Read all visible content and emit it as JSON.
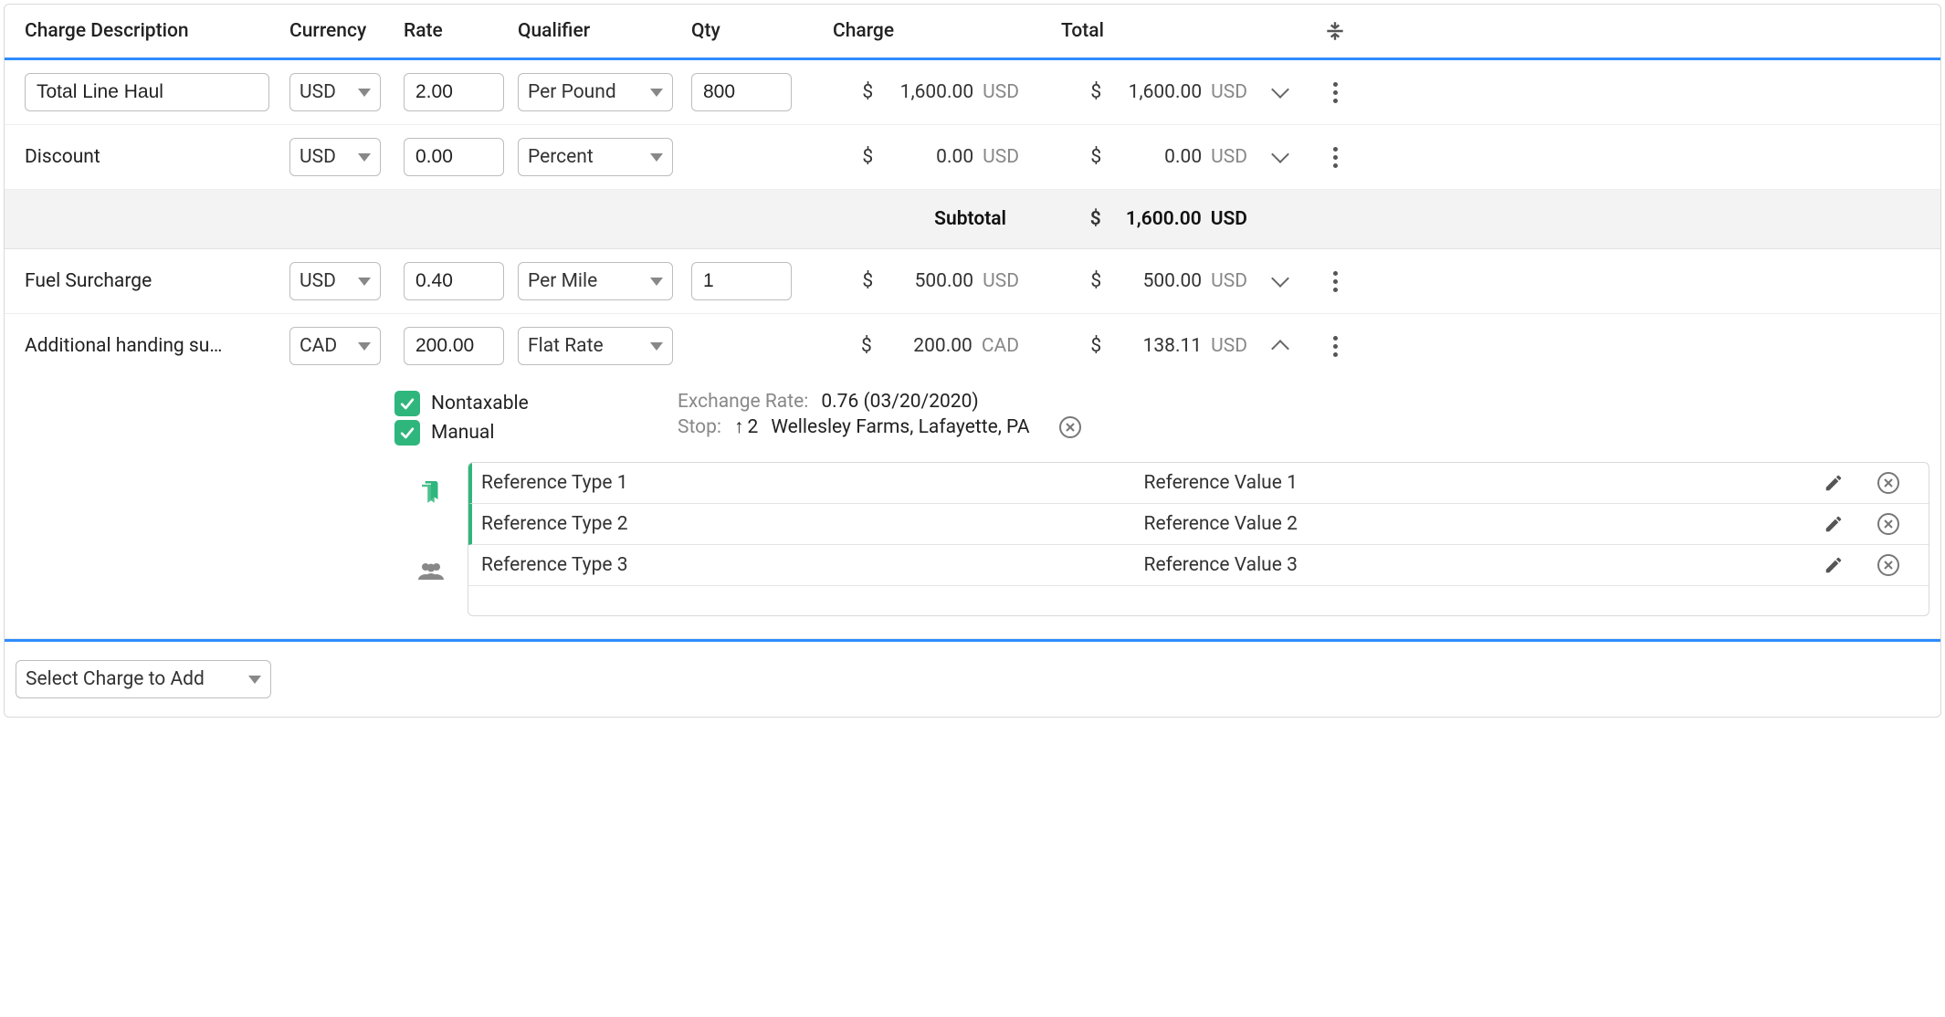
{
  "headers": {
    "description": "Charge Description",
    "currency": "Currency",
    "rate": "Rate",
    "qualifier": "Qualifier",
    "qty": "Qty",
    "charge": "Charge",
    "total": "Total"
  },
  "rows": [
    {
      "description": "Total Line Haul",
      "description_editable": true,
      "currency": "USD",
      "rate": "2.00",
      "qualifier": "Per Pound",
      "qty": "800",
      "qty_visible": true,
      "charge_sym": "$",
      "charge_val": "1,600.00",
      "charge_cur": "USD",
      "total_sym": "$",
      "total_val": "1,600.00",
      "total_cur": "USD",
      "expanded": false
    },
    {
      "description": "Discount",
      "description_editable": false,
      "currency": "USD",
      "rate": "0.00",
      "qualifier": "Percent",
      "qty": "",
      "qty_visible": false,
      "charge_sym": "$",
      "charge_val": "0.00",
      "charge_cur": "USD",
      "total_sym": "$",
      "total_val": "0.00",
      "total_cur": "USD",
      "expanded": false
    }
  ],
  "subtotal": {
    "label": "Subtotal",
    "sym": "$",
    "val": "1,600.00",
    "cur": "USD"
  },
  "rows2": [
    {
      "description": "Fuel Surcharge",
      "description_editable": false,
      "currency": "USD",
      "rate": "0.40",
      "qualifier": "Per Mile",
      "qty": "1",
      "qty_visible": true,
      "charge_sym": "$",
      "charge_val": "500.00",
      "charge_cur": "USD",
      "total_sym": "$",
      "total_val": "500.00",
      "total_cur": "USD",
      "expanded": false
    },
    {
      "description": "Additional handing su…",
      "description_editable": false,
      "currency": "CAD",
      "rate": "200.00",
      "qualifier": "Flat Rate",
      "qty": "",
      "qty_visible": false,
      "charge_sym": "$",
      "charge_val": "200.00",
      "charge_cur": "CAD",
      "total_sym": "$",
      "total_val": "138.11",
      "total_cur": "USD",
      "expanded": true
    }
  ],
  "detail": {
    "nontaxable_label": "Nontaxable",
    "manual_label": "Manual",
    "exchange_label": "Exchange Rate:",
    "exchange_value": "0.76 (03/20/2020)",
    "stop_label": "Stop:",
    "stop_num": "2",
    "stop_location": "Wellesley Farms, Lafayette, PA"
  },
  "references": [
    {
      "type": "Reference Type 1",
      "value": "Reference Value 1",
      "highlight": true
    },
    {
      "type": "Reference Type 2",
      "value": "Reference Value 2",
      "highlight": true
    },
    {
      "type": "Reference Type 3",
      "value": "Reference Value 3",
      "highlight": false
    }
  ],
  "footer": {
    "add_charge_label": "Select Charge to Add"
  }
}
